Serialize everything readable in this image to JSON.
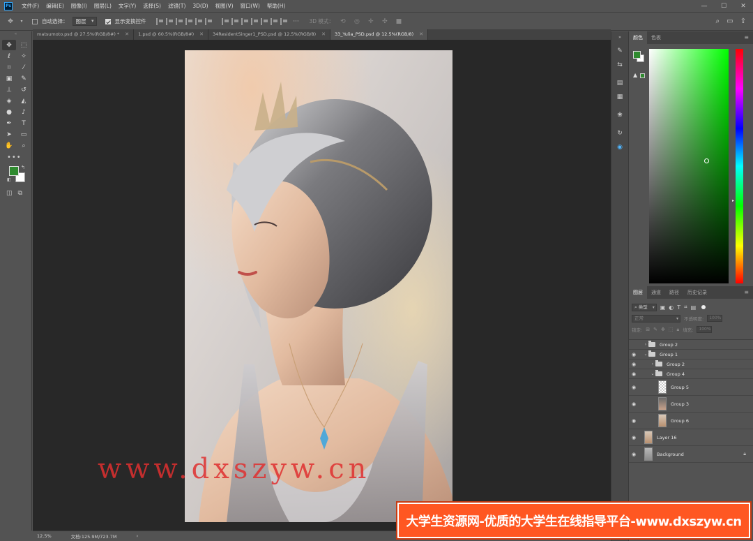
{
  "menubar": {
    "app_logo": "Ps",
    "items": [
      "文件(F)",
      "编辑(E)",
      "图像(I)",
      "图层(L)",
      "文字(Y)",
      "选择(S)",
      "滤镜(T)",
      "3D(D)",
      "视图(V)",
      "窗口(W)",
      "帮助(H)"
    ],
    "window_controls": {
      "minimize": "—",
      "maximize": "☐",
      "close": "✕"
    }
  },
  "optionsbar": {
    "auto_select_label": "自动选择：",
    "auto_select_target": "图层",
    "show_transform_label": "显示变换控件",
    "mode_3d_label": "3D 模式："
  },
  "toolbar": {
    "swatches": {
      "foreground": "#2f8a2f",
      "background": "#ffffff"
    }
  },
  "document_tabs": [
    {
      "label": "matsumoto.psd @ 27.5%(RGB/8#) *",
      "active": false
    },
    {
      "label": "1.psd @ 60.5%(RGB/8#)",
      "active": false
    },
    {
      "label": "34ResidentSinger1_PSD.psd @ 12.5%(RGB/8)",
      "active": false
    },
    {
      "label": "33_Yulia_PSD.psd @ 12.5%(RGB/8)",
      "active": true
    }
  ],
  "canvas": {
    "watermark": "www.dxszyw.cn"
  },
  "statusbar": {
    "zoom": "12.5%",
    "doc_size": "文档:125.9M/723.7M",
    "arrow": "›"
  },
  "color_panel": {
    "tabs": [
      "颜色",
      "色板"
    ],
    "foreground": "#2f8a2f",
    "background": "#ffffff"
  },
  "layers_panel": {
    "tabs": [
      "图层",
      "通道",
      "路径",
      "历史记录"
    ],
    "filter_kind": "类型",
    "blend_mode": "正常",
    "opacity_label": "不透明度:",
    "opacity_value": "100%",
    "lock_label": "锁定:",
    "fill_label": "填充:",
    "fill_value": "100%",
    "layers": [
      {
        "name": "Group 2",
        "type": "group",
        "visible": false,
        "expanded": false,
        "depth": 0
      },
      {
        "name": "Group 1",
        "type": "group",
        "visible": true,
        "expanded": true,
        "depth": 0
      },
      {
        "name": "Group 2",
        "type": "group",
        "visible": true,
        "expanded": false,
        "depth": 1
      },
      {
        "name": "Group 4",
        "type": "group",
        "visible": true,
        "expanded": true,
        "depth": 1
      },
      {
        "name": "Group 5",
        "type": "layer",
        "visible": true,
        "depth": 2
      },
      {
        "name": "Group 3",
        "type": "layer",
        "visible": true,
        "depth": 2
      },
      {
        "name": "Group 6",
        "type": "layer",
        "visible": true,
        "depth": 2
      },
      {
        "name": "Layer 16",
        "type": "layer",
        "visible": true,
        "depth": 0
      },
      {
        "name": "Background",
        "type": "layer",
        "visible": true,
        "depth": 0,
        "locked": true
      }
    ]
  },
  "banner": {
    "text": "大学生资源网-优质的大学生在线指导平台-www.dxszyw.cn"
  }
}
